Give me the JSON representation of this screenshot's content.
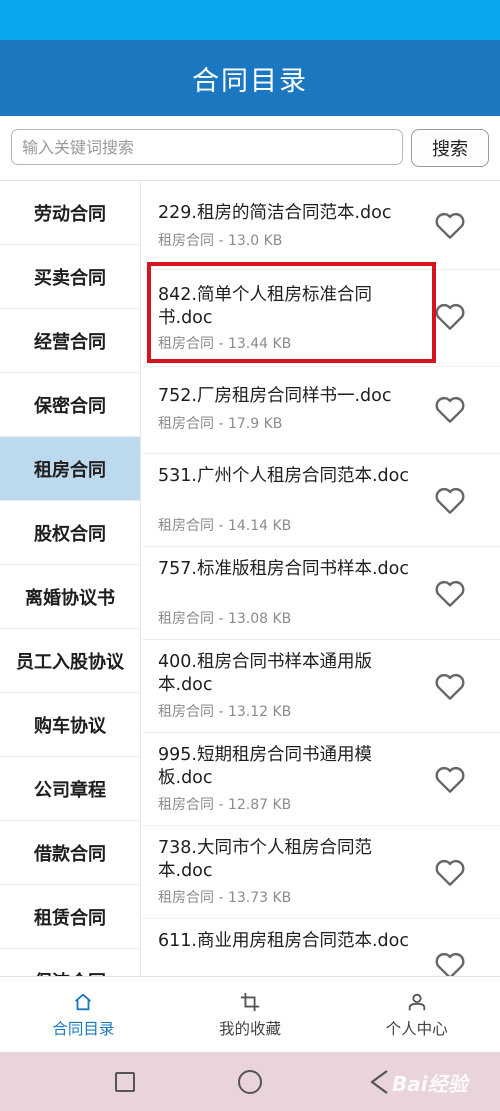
{
  "header": {
    "title": "合同目录"
  },
  "search": {
    "placeholder": "输入关键词搜索",
    "button_label": "搜索"
  },
  "sidebar": {
    "items": [
      "劳动合同",
      "买卖合同",
      "经营合同",
      "保密合同",
      "租房合同",
      "股权合同",
      "离婚协议书",
      "员工入股协议",
      "购车协议",
      "公司章程",
      "借款合同",
      "租赁合同",
      "保洁合同"
    ],
    "active": "租房合同"
  },
  "list": {
    "items": [
      {
        "title": "229.租房的简洁合同范本.doc",
        "meta": "租房合同 - 13.0 KB"
      },
      {
        "title": "842.简单个人租房标准合同书.doc",
        "meta": "租房合同 - 13.44 KB"
      },
      {
        "title": "752.厂房租房合同样书一.doc",
        "meta": "租房合同 - 17.9 KB"
      },
      {
        "title": "531.广州个人租房合同范本.doc",
        "meta": "租房合同 - 14.14 KB"
      },
      {
        "title": "757.标准版租房合同书样本.doc",
        "meta": "租房合同 - 13.08 KB"
      },
      {
        "title": "400.租房合同书样本通用版本.doc",
        "meta": "租房合同 - 13.12 KB"
      },
      {
        "title": "995.短期租房合同书通用模板.doc",
        "meta": "租房合同 - 12.87 KB"
      },
      {
        "title": "738.大同市个人租房合同范本.doc",
        "meta": "租房合同 - 13.73 KB"
      },
      {
        "title": "611.商业用房租房合同范本.doc",
        "meta": ""
      }
    ]
  },
  "tabbar": {
    "tabs": [
      {
        "label": "合同目录",
        "icon": "home-icon"
      },
      {
        "label": "我的收藏",
        "icon": "crop-icon"
      },
      {
        "label": "个人中心",
        "icon": "person-icon"
      }
    ],
    "active": "合同目录"
  },
  "watermark": {
    "text": "Bai经验"
  },
  "colors": {
    "header": "#1a77c0",
    "status_bar": "#0aa7ec",
    "sidebar_active": "#bcd9ee",
    "highlight": "#d6141c",
    "nav_bar": "#e9d4da"
  }
}
